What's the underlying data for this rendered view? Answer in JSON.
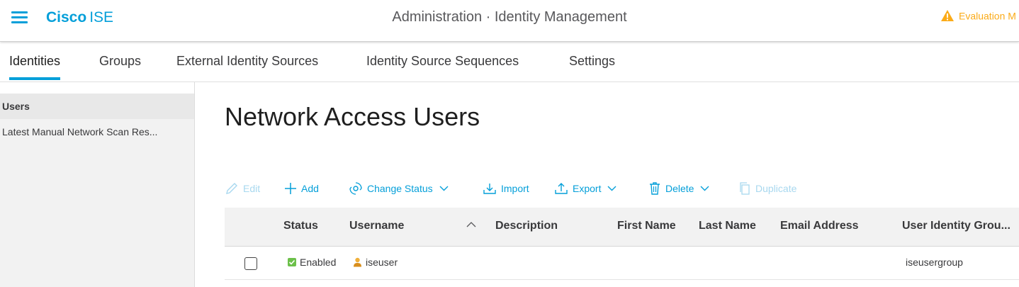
{
  "header": {
    "brand_bold": "Cisco",
    "brand_product": "ISE",
    "title": "Administration · Identity Management",
    "evaluation_text": "Evaluation M",
    "colors": {
      "accent": "#049fd9",
      "warning": "#fbab18"
    }
  },
  "tabs": [
    {
      "label": "Identities",
      "active": true
    },
    {
      "label": "Groups"
    },
    {
      "label": "External Identity Sources"
    },
    {
      "label": "Identity Source Sequences"
    },
    {
      "label": "Settings"
    }
  ],
  "sidebar": {
    "items": [
      {
        "label": "Users",
        "selected": true
      },
      {
        "label": "Latest Manual Network Scan Res..."
      }
    ]
  },
  "main": {
    "title": "Network Access Users",
    "toolbar": {
      "edit": "Edit",
      "add": "Add",
      "change_status": "Change Status",
      "import": "Import",
      "export": "Export",
      "delete": "Delete",
      "duplicate": "Duplicate"
    },
    "table": {
      "columns": [
        "Status",
        "Username",
        "Description",
        "First Name",
        "Last Name",
        "Email Address",
        "User Identity Grou..."
      ],
      "rows": [
        {
          "status": "Enabled",
          "username": "iseuser",
          "description": "",
          "first_name": "",
          "last_name": "",
          "email": "",
          "group": "iseusergroup"
        }
      ]
    }
  }
}
